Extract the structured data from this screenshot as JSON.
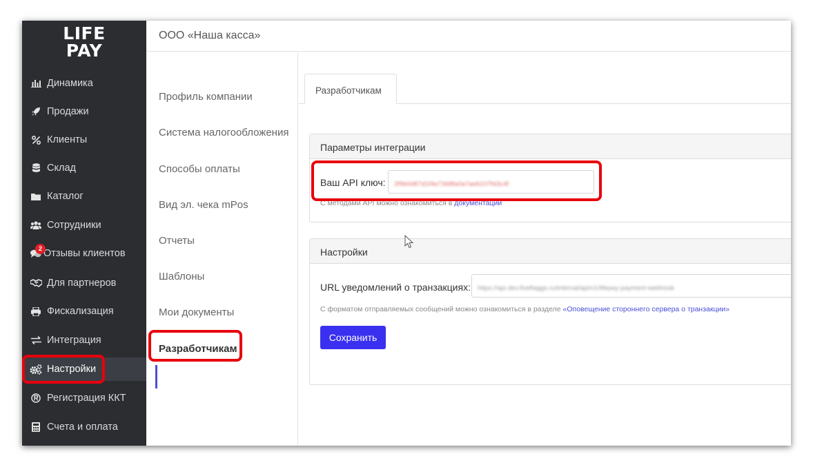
{
  "app": {
    "logo_line1": "LIFE",
    "logo_line2": "PAY",
    "company_name": "ООО «Наша касса»"
  },
  "sidebar": {
    "items": [
      {
        "label": "Динамика",
        "icon": "bar-chart-icon"
      },
      {
        "label": "Продажи",
        "icon": "rocket-icon"
      },
      {
        "label": "Клиенты",
        "icon": "percent-icon"
      },
      {
        "label": "Склад",
        "icon": "database-icon"
      },
      {
        "label": "Каталог",
        "icon": "folder-icon"
      },
      {
        "label": "Сотрудники",
        "icon": "users-icon"
      },
      {
        "label": "Отзывы клиентов",
        "icon": "comments-icon",
        "badge": "2"
      },
      {
        "label": "Для партнеров",
        "icon": "handshake-icon"
      },
      {
        "label": "Фискализация",
        "icon": "printer-icon"
      },
      {
        "label": "Интеграция",
        "icon": "exchange-icon"
      },
      {
        "label": "Настройки",
        "icon": "cogs-icon",
        "active": true
      },
      {
        "label": "Регистрация ККТ",
        "icon": "registered-icon"
      },
      {
        "label": "Счета и оплата",
        "icon": "calculator-icon"
      }
    ]
  },
  "settings_menu": {
    "items": [
      {
        "label": "Профиль компании"
      },
      {
        "label": "Система налогообложения"
      },
      {
        "label": "Способы оплаты"
      },
      {
        "label": "Вид эл. чека mPos"
      },
      {
        "label": "Отчеты"
      },
      {
        "label": "Шаблоны"
      },
      {
        "label": "Мои документы"
      },
      {
        "label": "Разработчикам",
        "active": true
      }
    ]
  },
  "main": {
    "tab_label": "Разработчикам",
    "integration": {
      "title": "Параметры интеграции",
      "api_key_label": "Ваш API ключ:",
      "api_key_value": "2f9b0d87d1f4e7368fa0a7ae6107fd3c4f",
      "hint_text": "С методами API можно ознакомиться в ",
      "hint_link": "документации"
    },
    "settings": {
      "title": "Настройки",
      "url_label": "URL уведомлений о транзакциях:",
      "url_value": "https://api.dev.fiveflaggs.ru/internal/api/v1/lifepay-payment-webhook",
      "hint_text": "С форматом отправляемых сообщений можно ознакомиться в разделе ",
      "hint_link": "«Оповещение стороннего сервера о транзакции»",
      "save_label": "Сохранить"
    }
  },
  "colors": {
    "sidebar_bg": "#2b2d31",
    "accent": "#3a30f0",
    "highlight_box": "#e8000d",
    "badge": "#e0202a"
  }
}
